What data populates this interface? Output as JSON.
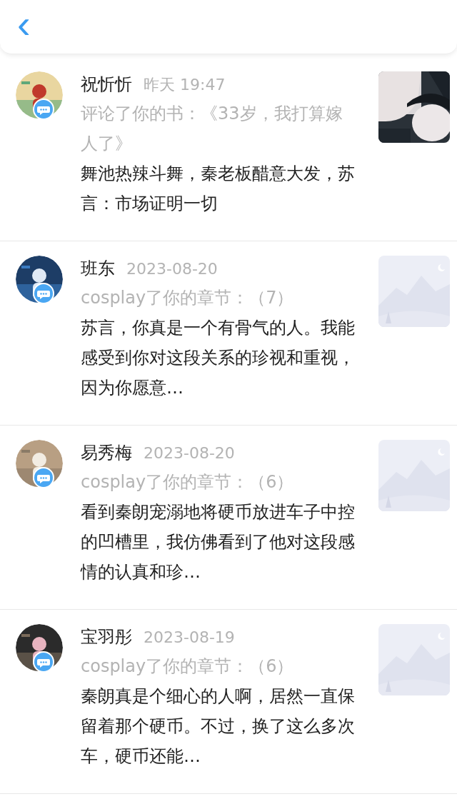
{
  "header": {
    "back": "‹"
  },
  "notifications": [
    {
      "name": "祝忻忻",
      "time": "昨天 19:47",
      "action": "评论了你的书：《33岁，我打算嫁人了》",
      "content": "舞池热辣斗舞，秦老板醋意大发，苏言：市场证明一切"
    },
    {
      "name": "班东",
      "time": "2023-08-20",
      "action": "cosplay了你的章节：（7）",
      "content": "苏言，你真是一个有骨气的人。我能感受到你对这段关系的珍视和重视，因为你愿意…",
      "thumbnail": {
        "kind": "placeholder"
      }
    },
    {
      "name": "易秀梅",
      "time": "2023-08-20",
      "action": "cosplay了你的章节：（6）",
      "content": "看到秦朗宠溺地将硬币放进车子中控的凹槽里，我仿佛看到了他对这段感情的认真和珍…",
      "thumbnail": {
        "kind": "placeholder"
      }
    },
    {
      "name": "宝羽彤",
      "time": "2023-08-19",
      "action": "cosplay了你的章节：（6）",
      "content": "秦朗真是个细心的人啊，居然一直保留着那个硬币。不过，换了这么多次车，硬币还能…",
      "thumbnail": {
        "kind": "placeholder"
      }
    }
  ]
}
